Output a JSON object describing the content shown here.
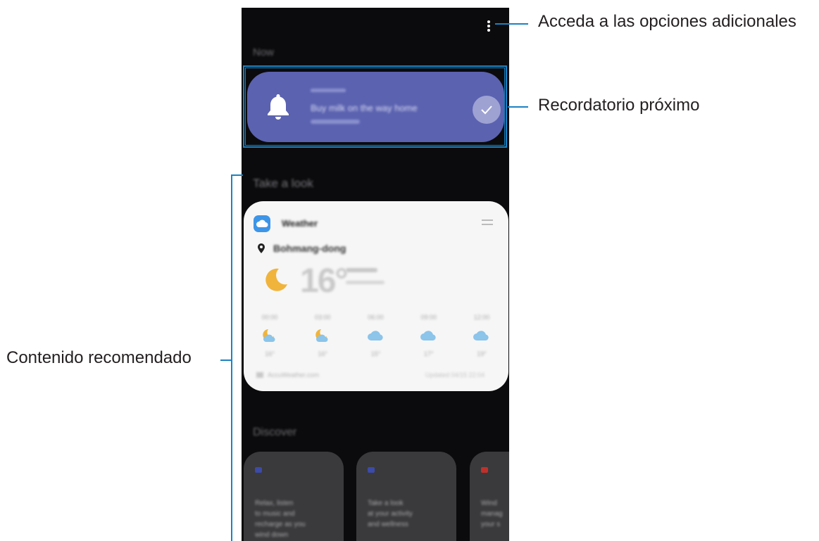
{
  "phone": {
    "section_now": "Now",
    "reminder": {
      "title": "Buy milk on the way home",
      "check_icon": "check-icon",
      "bell_icon": "bell-icon"
    },
    "section_take_a_look": "Take a look",
    "weather_card": {
      "app_name": "Weather",
      "location": "Bohmang-dong",
      "current_temp": "16°",
      "hours": [
        {
          "time": "00:00",
          "icon": "moon-cloud-icon",
          "temp": "16°"
        },
        {
          "time": "03:00",
          "icon": "moon-cloud-icon",
          "temp": "16°"
        },
        {
          "time": "06:00",
          "icon": "cloud-icon",
          "temp": "15°"
        },
        {
          "time": "09:00",
          "icon": "cloud-icon",
          "temp": "17°"
        },
        {
          "time": "12:00",
          "icon": "cloud-icon",
          "temp": "19°"
        }
      ],
      "footer_left": "AccuWeather.com",
      "footer_right": "Updated 04/15 22:04"
    },
    "section_discover": "Discover",
    "discover_cards": [
      {
        "text": "Relax, listen\nto music and\nrecharge as you\nwind down",
        "dot_color": "#3c4aa8"
      },
      {
        "text": "Take a look\nat your activity\nand wellness",
        "dot_color": "#3c4aa8"
      },
      {
        "text": "Wind\nmanag\nyour s",
        "dot_color": "#c0302a"
      }
    ]
  },
  "callouts": {
    "more_options": "Acceda a las opciones adicionales",
    "upcoming_reminder": "Recordatorio próximo",
    "recommended_content": "Contenido recomendado"
  },
  "colors": {
    "callout_line": "#1b82c3",
    "reminder_card": "#5b62b0",
    "phone_bg": "#0b0b0d"
  }
}
